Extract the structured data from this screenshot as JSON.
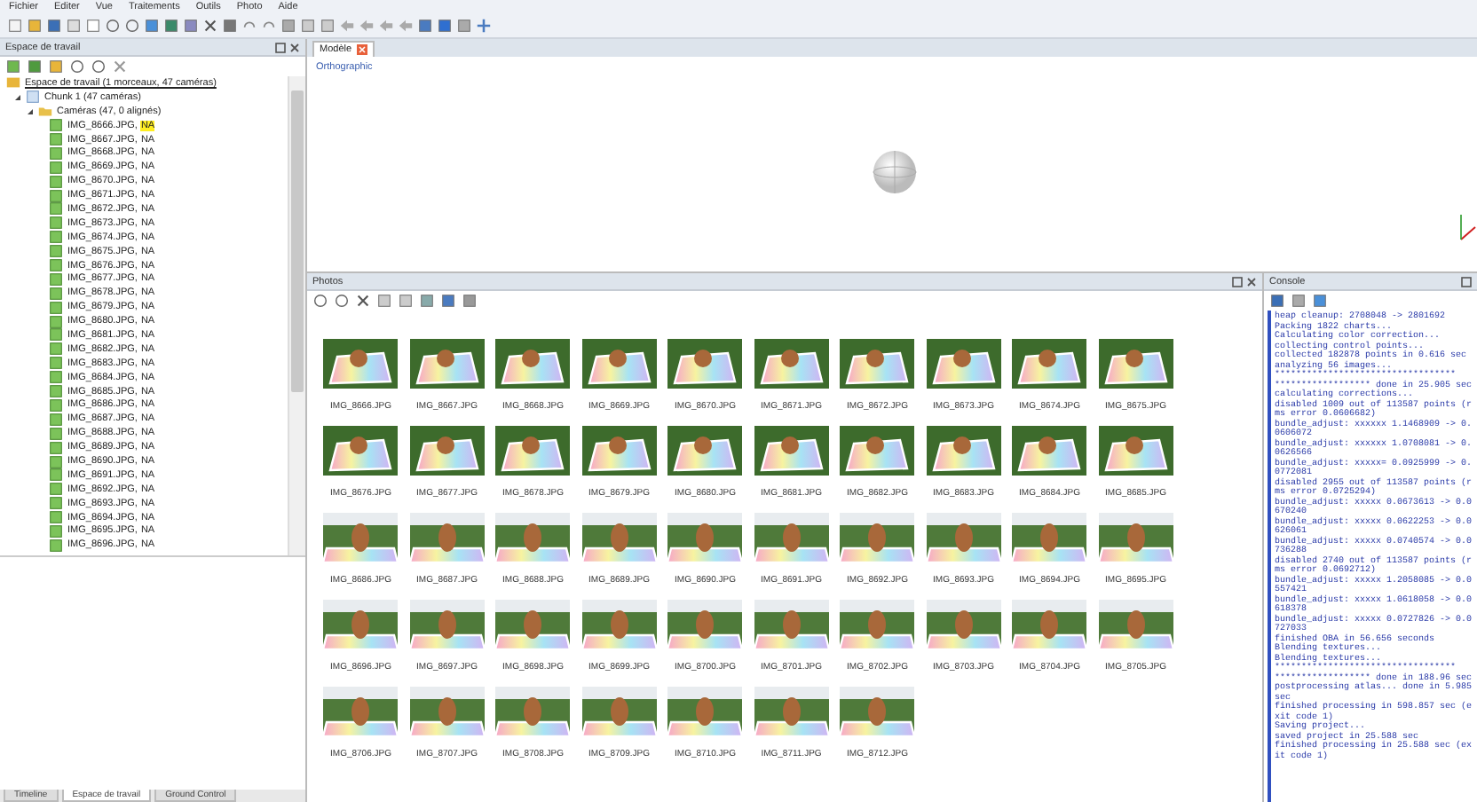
{
  "menu": [
    "Fichier",
    "Editer",
    "Vue",
    "Traitements",
    "Outils",
    "Photo",
    "Aide"
  ],
  "workspace": {
    "title": "Espace de travail",
    "root": "Espace de travail (1 morceaux, 47 caméras)",
    "chunk": {
      "label": "Chunk 1 (47 caméras)",
      "expanded": true
    },
    "folder": {
      "label": "Caméras (47, 0 alignés)",
      "expanded": true
    },
    "cameras": [
      {
        "name": "IMG_8666.JPG,",
        "status": "NA",
        "highlighted": true
      },
      {
        "name": "IMG_8667.JPG,",
        "status": "NA",
        "highlighted": false
      },
      {
        "name": "IMG_8668.JPG,",
        "status": "NA",
        "highlighted": false
      },
      {
        "name": "IMG_8669.JPG,",
        "status": "NA",
        "highlighted": false
      },
      {
        "name": "IMG_8670.JPG,",
        "status": "NA",
        "highlighted": false
      },
      {
        "name": "IMG_8671.JPG,",
        "status": "NA",
        "highlighted": false
      },
      {
        "name": "IMG_8672.JPG,",
        "status": "NA",
        "highlighted": false
      },
      {
        "name": "IMG_8673.JPG,",
        "status": "NA",
        "highlighted": false
      },
      {
        "name": "IMG_8674.JPG,",
        "status": "NA",
        "highlighted": false
      },
      {
        "name": "IMG_8675.JPG,",
        "status": "NA",
        "highlighted": false
      },
      {
        "name": "IMG_8676.JPG,",
        "status": "NA",
        "highlighted": false
      },
      {
        "name": "IMG_8677.JPG,",
        "status": "NA",
        "highlighted": false
      },
      {
        "name": "IMG_8678.JPG,",
        "status": "NA",
        "highlighted": false
      },
      {
        "name": "IMG_8679.JPG,",
        "status": "NA",
        "highlighted": false
      },
      {
        "name": "IMG_8680.JPG,",
        "status": "NA",
        "highlighted": false
      },
      {
        "name": "IMG_8681.JPG,",
        "status": "NA",
        "highlighted": false
      },
      {
        "name": "IMG_8682.JPG,",
        "status": "NA",
        "highlighted": false
      },
      {
        "name": "IMG_8683.JPG,",
        "status": "NA",
        "highlighted": false
      },
      {
        "name": "IMG_8684.JPG,",
        "status": "NA",
        "highlighted": false
      },
      {
        "name": "IMG_8685.JPG,",
        "status": "NA",
        "highlighted": false
      },
      {
        "name": "IMG_8686.JPG,",
        "status": "NA",
        "highlighted": false
      },
      {
        "name": "IMG_8687.JPG,",
        "status": "NA",
        "highlighted": false
      },
      {
        "name": "IMG_8688.JPG,",
        "status": "NA",
        "highlighted": false
      },
      {
        "name": "IMG_8689.JPG,",
        "status": "NA",
        "highlighted": false
      },
      {
        "name": "IMG_8690.JPG,",
        "status": "NA",
        "highlighted": false
      },
      {
        "name": "IMG_8691.JPG,",
        "status": "NA",
        "highlighted": false
      },
      {
        "name": "IMG_8692.JPG,",
        "status": "NA",
        "highlighted": false
      },
      {
        "name": "IMG_8693.JPG,",
        "status": "NA",
        "highlighted": false
      },
      {
        "name": "IMG_8694.JPG,",
        "status": "NA",
        "highlighted": false
      },
      {
        "name": "IMG_8695.JPG,",
        "status": "NA",
        "highlighted": false
      },
      {
        "name": "IMG_8696.JPG,",
        "status": "NA",
        "highlighted": false
      }
    ]
  },
  "model": {
    "tab": "Modèle",
    "projection": "Orthographic"
  },
  "photos": {
    "title": "Photos",
    "items": [
      "IMG_8666.JPG",
      "IMG_8667.JPG",
      "IMG_8668.JPG",
      "IMG_8669.JPG",
      "IMG_8670.JPG",
      "IMG_8671.JPG",
      "IMG_8672.JPG",
      "IMG_8673.JPG",
      "IMG_8674.JPG",
      "IMG_8675.JPG",
      "IMG_8676.JPG",
      "IMG_8677.JPG",
      "IMG_8678.JPG",
      "IMG_8679.JPG",
      "IMG_8680.JPG",
      "IMG_8681.JPG",
      "IMG_8682.JPG",
      "IMG_8683.JPG",
      "IMG_8684.JPG",
      "IMG_8685.JPG",
      "IMG_8686.JPG",
      "IMG_8687.JPG",
      "IMG_8688.JPG",
      "IMG_8689.JPG",
      "IMG_8690.JPG",
      "IMG_8691.JPG",
      "IMG_8692.JPG",
      "IMG_8693.JPG",
      "IMG_8694.JPG",
      "IMG_8695.JPG",
      "IMG_8696.JPG",
      "IMG_8697.JPG",
      "IMG_8698.JPG",
      "IMG_8699.JPG",
      "IMG_8700.JPG",
      "IMG_8701.JPG",
      "IMG_8702.JPG",
      "IMG_8703.JPG",
      "IMG_8704.JPG",
      "IMG_8705.JPG",
      "IMG_8706.JPG",
      "IMG_8707.JPG",
      "IMG_8708.JPG",
      "IMG_8709.JPG",
      "IMG_8710.JPG",
      "IMG_8711.JPG",
      "IMG_8712.JPG"
    ]
  },
  "console": {
    "title": "Console",
    "lines": [
      "heap cleanup: 2708048 -> 2801692",
      "Packing 1822 charts...",
      "Calculating color correction...",
      "collecting control points...",
      "collected 182878 points in 0.616 sec",
      "analyzing 56 images...",
      "**********************************",
      "****************** done in 25.905 sec",
      "calculating corrections...",
      "disabled 1009 out of 113587 points (rms error 0.0606682)",
      "bundle_adjust: xxxxxx 1.1468909 -> 0.0606072",
      "bundle_adjust: xxxxxx 1.0708081 -> 0.0626566",
      "bundle_adjust: xxxxx= 0.0925999 -> 0.0772081",
      "disabled 2955 out of 113587 points (rms error 0.0725294)",
      "bundle_adjust: xxxxx 0.0673613 -> 0.0670240",
      "bundle_adjust: xxxxx 0.0622253 -> 0.0626061",
      "bundle_adjust: xxxxx 0.0740574 -> 0.0736288",
      "disabled 2740 out of 113587 points (rms error 0.0692712)",
      "bundle_adjust: xxxxx 1.2058085 -> 0.0557421",
      "bundle_adjust: xxxxx 1.0618058 -> 0.0618378",
      "bundle_adjust: xxxxx 0.0727826 -> 0.0727033",
      "finished OBA in 56.656 seconds",
      "Blending textures...",
      "Blending textures...",
      "**********************************",
      "****************** done in 188.96 sec",
      "postprocessing atlas... done in 5.985 sec",
      "finished processing in 598.857 sec (exit code 1)",
      "Saving project...",
      "saved project in 25.588 sec",
      "finished processing in 25.588 sec (exit code 1)"
    ]
  },
  "bottom_tabs": [
    {
      "label": "Timeline",
      "selected": false
    },
    {
      "label": "Espace de travail",
      "selected": true
    },
    {
      "label": "Ground Control",
      "selected": false
    }
  ]
}
